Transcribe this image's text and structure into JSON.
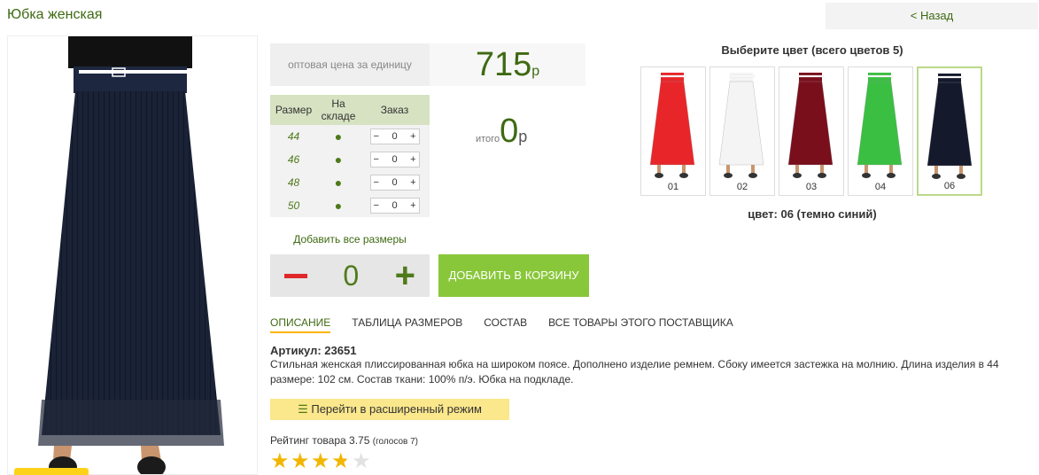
{
  "page": {
    "title": "Юбка женская",
    "back_label": "< Назад"
  },
  "price": {
    "label": "оптовая цена за единицу",
    "value": "715",
    "currency": "р"
  },
  "sizes_table": {
    "headers": [
      "Размер",
      "На складе",
      "Заказ"
    ],
    "rows": [
      {
        "size": "44",
        "stock": "●",
        "qty": "0"
      },
      {
        "size": "46",
        "stock": "●",
        "qty": "0"
      },
      {
        "size": "48",
        "stock": "●",
        "qty": "0"
      },
      {
        "size": "50",
        "stock": "●",
        "qty": "0"
      }
    ]
  },
  "total": {
    "label": "итого",
    "value": "0",
    "currency": "р"
  },
  "add_all_label": "Добавить все размеры",
  "quantity": "0",
  "add_to_cart_label": "ДОБАВИТЬ В КОРЗИНУ",
  "colors": {
    "title": "Выберите цвет (всего цветов 5)",
    "items": [
      {
        "num": "01",
        "hex": "#e8262a"
      },
      {
        "num": "02",
        "hex": "#f4f4f4"
      },
      {
        "num": "03",
        "hex": "#7a0f1c"
      },
      {
        "num": "04",
        "hex": "#3bbf43"
      },
      {
        "num": "06",
        "hex": "#141a2c"
      }
    ],
    "selected_index": 4,
    "current_label": "цвет: 06 (темно синий)"
  },
  "tabs": [
    "ОПИСАНИЕ",
    "ТАБЛИЦА РАЗМЕРОВ",
    "СОСТАВ",
    "ВСЕ ТОВАРЫ ЭТОГО ПОСТАВЩИКА"
  ],
  "sku": "Артикул: 23651",
  "description": "Стильная женская плиссированная юбка на широком поясе. Дополнено изделие ремнем. Сбоку имеется застежка на молнию. Длина изделия в 44 размере: 102 см. Состав ткани: 100% п/э. Юбка на подкладе.",
  "advanced_mode_label": "Перейти в расширенный режим",
  "rating": {
    "text": "Рейтинг товара 3.75",
    "votes": "(голосов 7)",
    "value": 3.75,
    "max": 5
  }
}
